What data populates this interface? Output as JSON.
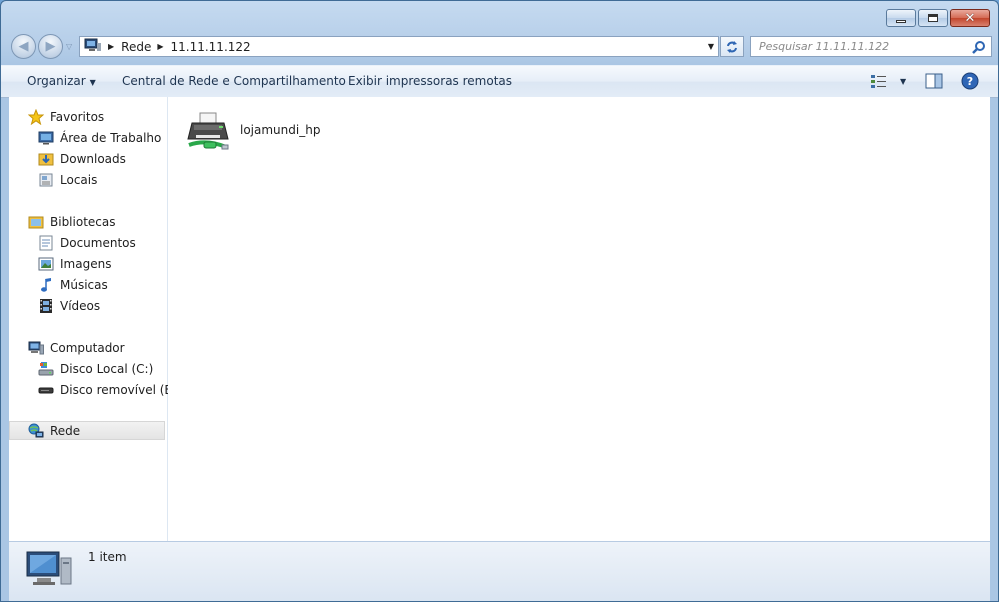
{
  "window": {
    "controls": {
      "minimize": "minimize",
      "maximize": "maximize",
      "close": "✕"
    }
  },
  "address": {
    "crumbs": [
      "Rede",
      "11.11.11.122"
    ]
  },
  "search": {
    "placeholder": "Pesquisar 11.11.11.122"
  },
  "commands": {
    "organizar": "Organizar",
    "central": "Central de Rede e Compartilhamento",
    "exibir": "Exibir impressoras remotas"
  },
  "sidebar": {
    "favoritos": "Favoritos",
    "favorites_items": [
      "Área de Trabalho",
      "Downloads",
      "Locais"
    ],
    "bibliotecas": "Bibliotecas",
    "library_items": [
      "Documentos",
      "Imagens",
      "Músicas",
      "Vídeos"
    ],
    "computador": "Computador",
    "computer_items": [
      "Disco Local (C:)",
      "Disco removível (E:)"
    ],
    "rede": "Rede"
  },
  "content": {
    "items": [
      {
        "name": "lojamundi_hp"
      }
    ]
  },
  "status": {
    "count": "1 item"
  },
  "colors": {
    "accent": "#3a76b9",
    "selection": "#e4e4e4",
    "window_frame": "#b7cfe9"
  }
}
